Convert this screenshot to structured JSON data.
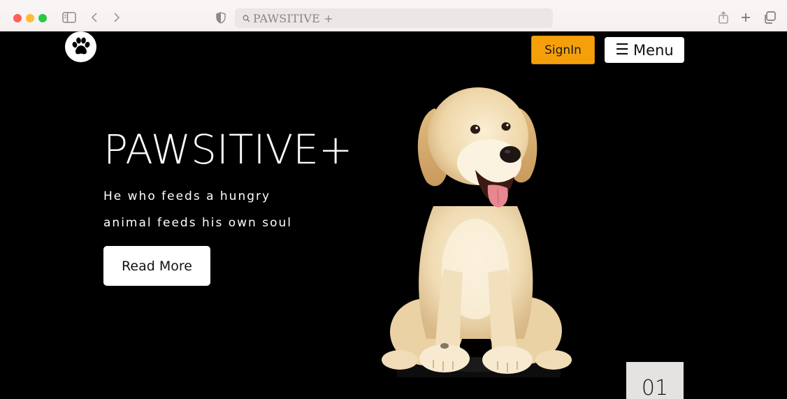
{
  "browser": {
    "address_text": "PAWSITIVE +",
    "icons": {
      "sidebar": "sidebar-icon",
      "back": "chevron-left-icon",
      "forward": "chevron-right-icon",
      "shield": "shield-icon",
      "search": "search-icon",
      "share": "share-icon",
      "new_tab": "plus-icon",
      "tabs": "tabs-icon"
    }
  },
  "header": {
    "logo_icon": "paw-icon",
    "signin_label": "SignIn",
    "menu_icon": "hamburger-icon",
    "menu_label": "Menu"
  },
  "hero": {
    "title": "PAWSITIVE+",
    "line1": "He who feeds a hungry",
    "line2": "animal feeds his own soul",
    "read_more_label": "Read More",
    "image": "puppy-image"
  },
  "slider": {
    "counter": "01"
  },
  "colors": {
    "background": "#000000",
    "signin_accent": "#f5a00b",
    "counter_bg": "#e5e3e1"
  }
}
